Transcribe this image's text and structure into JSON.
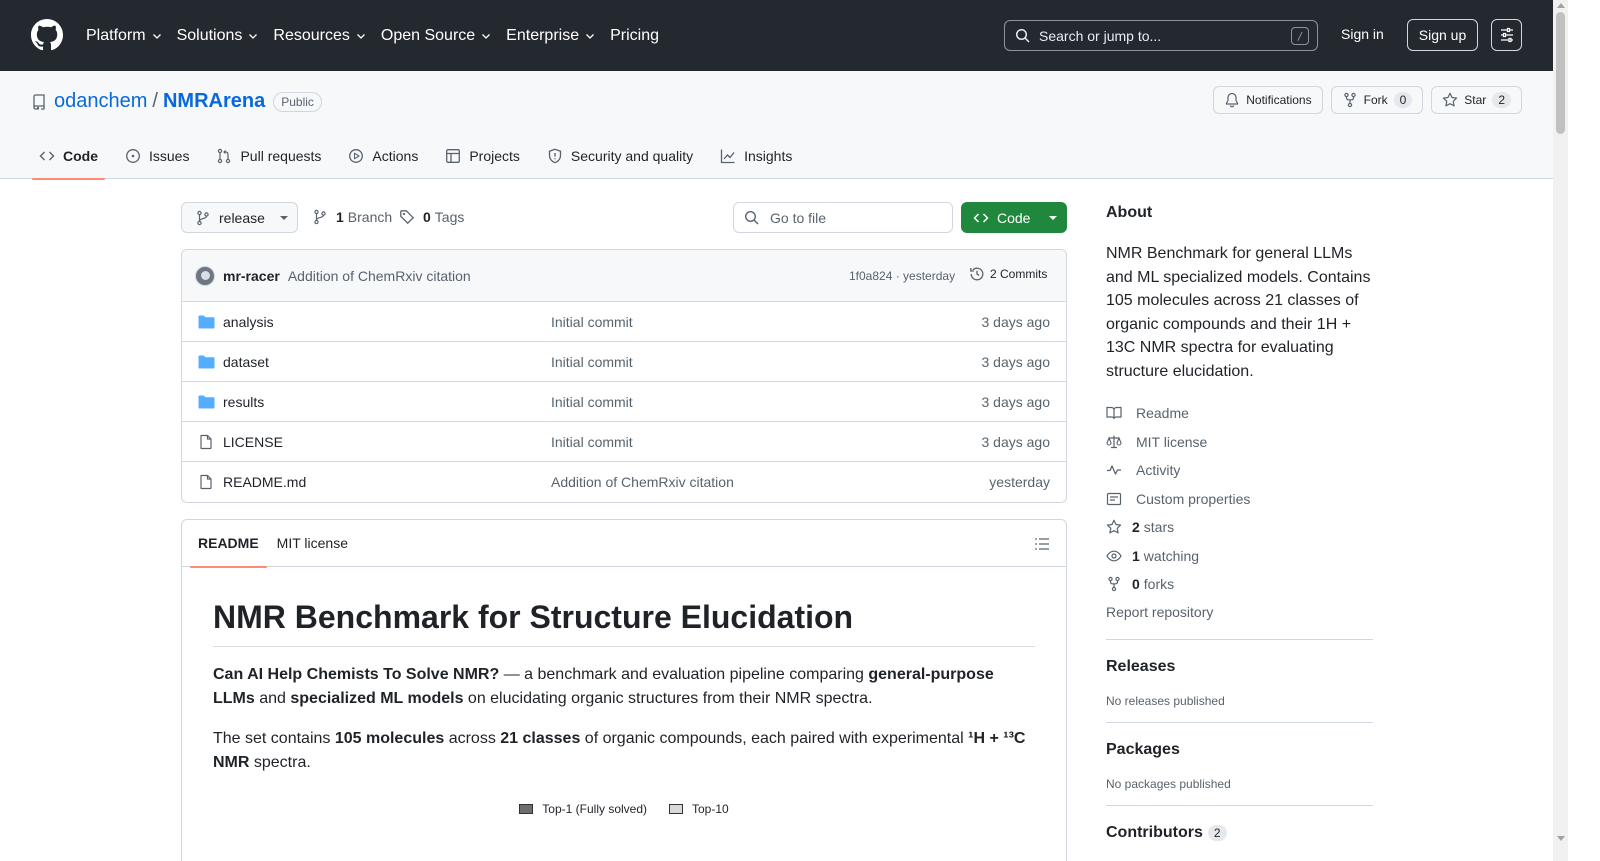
{
  "header": {
    "nav": [
      {
        "label": "Platform",
        "dropdown": true
      },
      {
        "label": "Solutions",
        "dropdown": true
      },
      {
        "label": "Resources",
        "dropdown": true
      },
      {
        "label": "Open Source",
        "dropdown": true
      },
      {
        "label": "Enterprise",
        "dropdown": true
      },
      {
        "label": "Pricing",
        "dropdown": false
      }
    ],
    "search_placeholder": "Search or jump to...",
    "search_key": "/",
    "sign_in": "Sign in",
    "sign_up": "Sign up"
  },
  "repo": {
    "owner": "odanchem",
    "separator": "/",
    "name": "NMRArena",
    "visibility": "Public",
    "notifications_label": "Notifications",
    "fork_label": "Fork",
    "fork_count": "0",
    "star_label": "Star",
    "star_count": "2",
    "tabs": [
      {
        "label": "Code",
        "icon": "code-icon",
        "active": true
      },
      {
        "label": "Issues",
        "icon": "issue-icon",
        "active": false
      },
      {
        "label": "Pull requests",
        "icon": "pull-request-icon",
        "active": false
      },
      {
        "label": "Actions",
        "icon": "play-icon",
        "active": false
      },
      {
        "label": "Projects",
        "icon": "table-icon",
        "active": false
      },
      {
        "label": "Security and quality",
        "icon": "shield-icon",
        "active": false
      },
      {
        "label": "Insights",
        "icon": "graph-icon",
        "active": false
      }
    ]
  },
  "files": {
    "branch": "release",
    "branch_count": "1",
    "branch_label": "Branch",
    "tag_count": "0",
    "tag_label": "Tags",
    "goto_placeholder": "Go to file",
    "code_button": "Code",
    "latest_commit": {
      "author": "mr-racer",
      "message": "Addition of ChemRxiv citation",
      "sha_time": "1f0a824 · yesterday",
      "commits": "2 Commits"
    },
    "rows": [
      {
        "type": "folder",
        "name": "analysis",
        "message": "Initial commit",
        "age": "3 days ago"
      },
      {
        "type": "folder",
        "name": "dataset",
        "message": "Initial commit",
        "age": "3 days ago"
      },
      {
        "type": "folder",
        "name": "results",
        "message": "Initial commit",
        "age": "3 days ago"
      },
      {
        "type": "file",
        "name": "LICENSE",
        "message": "Initial commit",
        "age": "3 days ago"
      },
      {
        "type": "file",
        "name": "README.md",
        "message": "Addition of ChemRxiv citation",
        "age": "yesterday"
      }
    ]
  },
  "readme": {
    "tabs": [
      "README",
      "MIT license"
    ],
    "title": "NMR Benchmark for Structure Elucidation",
    "p1": {
      "b1": "Can AI Help Chemists To Solve NMR?",
      "t1": " — a benchmark and evaluation pipeline comparing ",
      "b2": "general-purpose LLMs",
      "t2": " and ",
      "b3": "specialized ML models",
      "t3": " on elucidating organic structures from their NMR spectra."
    },
    "p2": {
      "t1": "The set contains ",
      "b1": "105 molecules",
      "t2": " across ",
      "b2": "21 classes",
      "t3": " of organic compounds, each paired with experimental ",
      "b3": "¹H + ¹³C NMR",
      "t4": " spectra."
    },
    "legend": [
      {
        "label": "Top-1 (Fully solved)",
        "color": "#6e6e6e"
      },
      {
        "label": "Top-10",
        "color": "#d9d9d9"
      }
    ]
  },
  "sidebar": {
    "about_heading": "About",
    "description": "NMR Benchmark for general LLMs and ML specialized models. Contains 105 molecules across 21 classes of organic compounds and their 1H + 13C NMR spectra for evaluating structure elucidation.",
    "links": [
      {
        "icon": "book-icon",
        "count": "",
        "label": "Readme"
      },
      {
        "icon": "law-icon",
        "count": "",
        "label": "MIT license"
      },
      {
        "icon": "pulse-icon",
        "count": "",
        "label": "Activity"
      },
      {
        "icon": "note-icon",
        "count": "",
        "label": "Custom properties"
      },
      {
        "icon": "star-icon",
        "count": "2",
        "label": "stars"
      },
      {
        "icon": "eye-icon",
        "count": "1",
        "label": "watching"
      },
      {
        "icon": "fork-icon",
        "count": "0",
        "label": "forks"
      }
    ],
    "report": "Report repository",
    "releases_heading": "Releases",
    "releases_text": "No releases published",
    "packages_heading": "Packages",
    "packages_text": "No packages published",
    "contributors_heading": "Contributors",
    "contributors_count": "2"
  },
  "colors": {
    "header_bg": "#24292f",
    "link": "#0969da",
    "primary_button": "#1f883d",
    "active_tab_underline": "#fd8c73"
  }
}
